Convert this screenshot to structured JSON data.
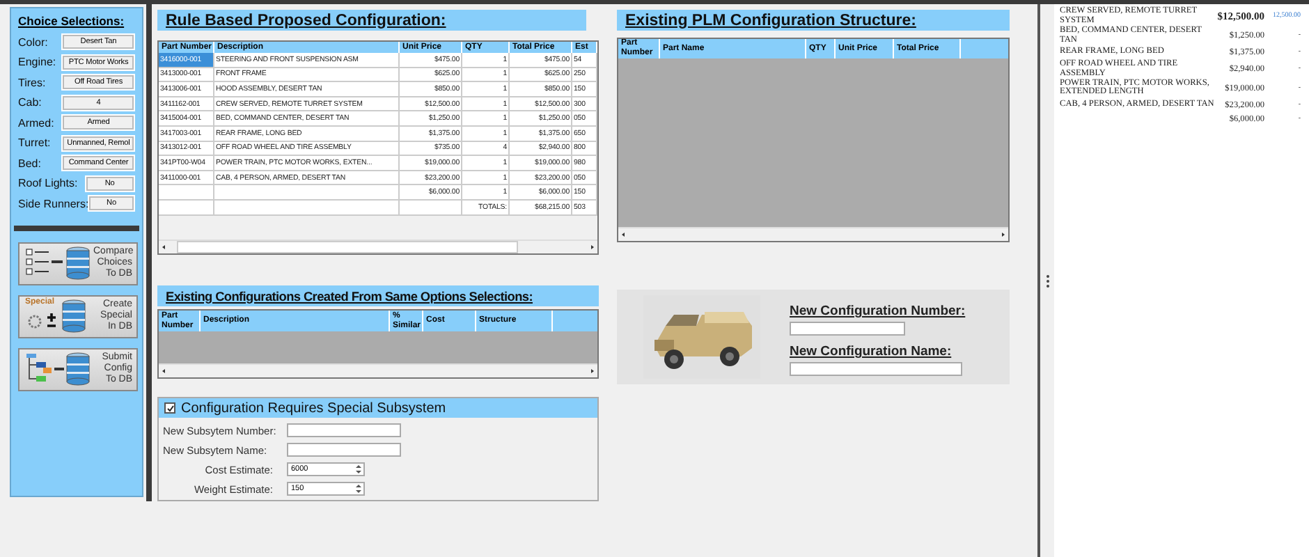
{
  "choices": {
    "title": "Choice Selections:",
    "fields": [
      {
        "label": "Color:",
        "value": "Desert Tan",
        "kind": "wide"
      },
      {
        "label": "Engine:",
        "value": "PTC Motor Works",
        "kind": "wide"
      },
      {
        "label": "Tires:",
        "value": "Off Road Tires",
        "kind": "wide"
      },
      {
        "label": "Cab:",
        "value": "4",
        "kind": "wide"
      },
      {
        "label": "Armed:",
        "value": "Armed",
        "kind": "wide"
      },
      {
        "label": "Turret:",
        "value": "Unmanned, Remol",
        "kind": "wide"
      },
      {
        "label": "Bed:",
        "value": "Command Center",
        "kind": "wide"
      },
      {
        "label": "Roof Lights:",
        "value": "No",
        "kind": "narrow"
      },
      {
        "label": "Side Runners:",
        "value": "No",
        "kind": "narrow"
      }
    ],
    "buttons": [
      {
        "kind": "compare",
        "label": "Compare Choices To DB"
      },
      {
        "kind": "special",
        "badge": "Special",
        "label": "Create Special In DB"
      },
      {
        "kind": "submit",
        "label": "Submit Config To DB"
      }
    ]
  },
  "proposed": {
    "title": "Rule Based Proposed Configuration:",
    "columns": [
      "Part Number",
      "Description",
      "Unit Price",
      "QTY",
      "Total Price",
      "Est"
    ],
    "rows": [
      {
        "cells": [
          "3416000-001",
          "STEERING AND FRONT SUSPENSION ASM",
          "$475.00",
          "1",
          "$475.00",
          "54"
        ],
        "selected": true
      },
      {
        "cells": [
          "3413000-001",
          "FRONT FRAME",
          "$625.00",
          "1",
          "$625.00",
          "250"
        ],
        "selected": false
      },
      {
        "cells": [
          "3413006-001",
          "HOOD ASSEMBLY, DESERT TAN",
          "$850.00",
          "1",
          "$850.00",
          "150"
        ],
        "selected": false
      },
      {
        "cells": [
          "3411162-001",
          "CREW SERVED, REMOTE TURRET SYSTEM",
          "$12,500.00",
          "1",
          "$12,500.00",
          "300"
        ],
        "selected": false
      },
      {
        "cells": [
          "3415004-001",
          "BED, COMMAND CENTER, DESERT TAN",
          "$1,250.00",
          "1",
          "$1,250.00",
          "050"
        ],
        "selected": false
      },
      {
        "cells": [
          "3417003-001",
          "REAR FRAME,  LONG BED",
          "$1,375.00",
          "1",
          "$1,375.00",
          "650"
        ],
        "selected": false
      },
      {
        "cells": [
          "3413012-001",
          "OFF ROAD WHEEL AND TIRE ASSEMBLY",
          "$735.00",
          "4",
          "$2,940.00",
          "800"
        ],
        "selected": false
      },
      {
        "cells": [
          "341PT00-W04",
          "POWER TRAIN, PTC MOTOR WORKS, EXTEN...",
          "$19,000.00",
          "1",
          "$19,000.00",
          "980"
        ],
        "selected": false
      },
      {
        "cells": [
          "3411000-001",
          "CAB, 4 PERSON, ARMED, DESERT TAN",
          "$23,200.00",
          "1",
          "$23,200.00",
          "050"
        ],
        "selected": false
      },
      {
        "cells": [
          "",
          "",
          "$6,000.00",
          "1",
          "$6,000.00",
          "150"
        ],
        "selected": false
      },
      {
        "cells": [
          "",
          "",
          "",
          "TOTALS:",
          "$68,215.00",
          "503"
        ],
        "selected": false
      }
    ]
  },
  "plm": {
    "title": "Existing PLM Configuration Structure:",
    "columns": [
      "Part Number",
      "Part Name",
      "QTY",
      "Unit Price",
      "Total Price"
    ]
  },
  "existing": {
    "title": "Existing Configurations Created From Same Options Selections:",
    "columns": [
      "Part Number",
      "Description",
      "% Similar",
      "Cost",
      "Structure"
    ]
  },
  "new_config": {
    "number_label": "New Configuration Number:",
    "name_label": "New Configuration Name:"
  },
  "subsystem": {
    "label": "Configuration Requires Special Subsystem",
    "checked": true,
    "fields": [
      {
        "label": "New Subsytem Number:",
        "kind": "text"
      },
      {
        "label": "New Subsytem Name:",
        "kind": "text"
      },
      {
        "label": "Cost Estimate:",
        "value": "6000",
        "kind": "spin"
      },
      {
        "label": "Weight Estimate:",
        "value": "150",
        "kind": "spin"
      }
    ]
  },
  "document": {
    "rows": [
      {
        "description": "CREW SERVED, REMOTE TURRET SYSTEM",
        "price": "$12,500.00",
        "column_3": "12,500.00",
        "highlight": true
      },
      {
        "description": "BED, COMMAND CENTER, DESERT TAN",
        "price": "$1,250.00",
        "column_3": "-",
        "highlight": false
      },
      {
        "description": "REAR FRAME, LONG BED",
        "price": "$1,375.00",
        "column_3": "-",
        "highlight": false
      },
      {
        "description": "OFF ROAD WHEEL AND TIRE ASSEMBLY",
        "price": "$2,940.00",
        "column_3": "-",
        "highlight": false
      },
      {
        "description": "POWER TRAIN, PTC MOTOR WORKS, EXTENDED LENGTH",
        "price": "$19,000.00",
        "column_3": "-",
        "highlight": false
      },
      {
        "description": "CAB, 4 PERSON, ARMED, DESERT TAN",
        "price": "$23,200.00",
        "column_3": "-",
        "highlight": false
      },
      {
        "description": "",
        "price": "$6,000.00",
        "column_3": "-",
        "highlight": false
      }
    ]
  }
}
